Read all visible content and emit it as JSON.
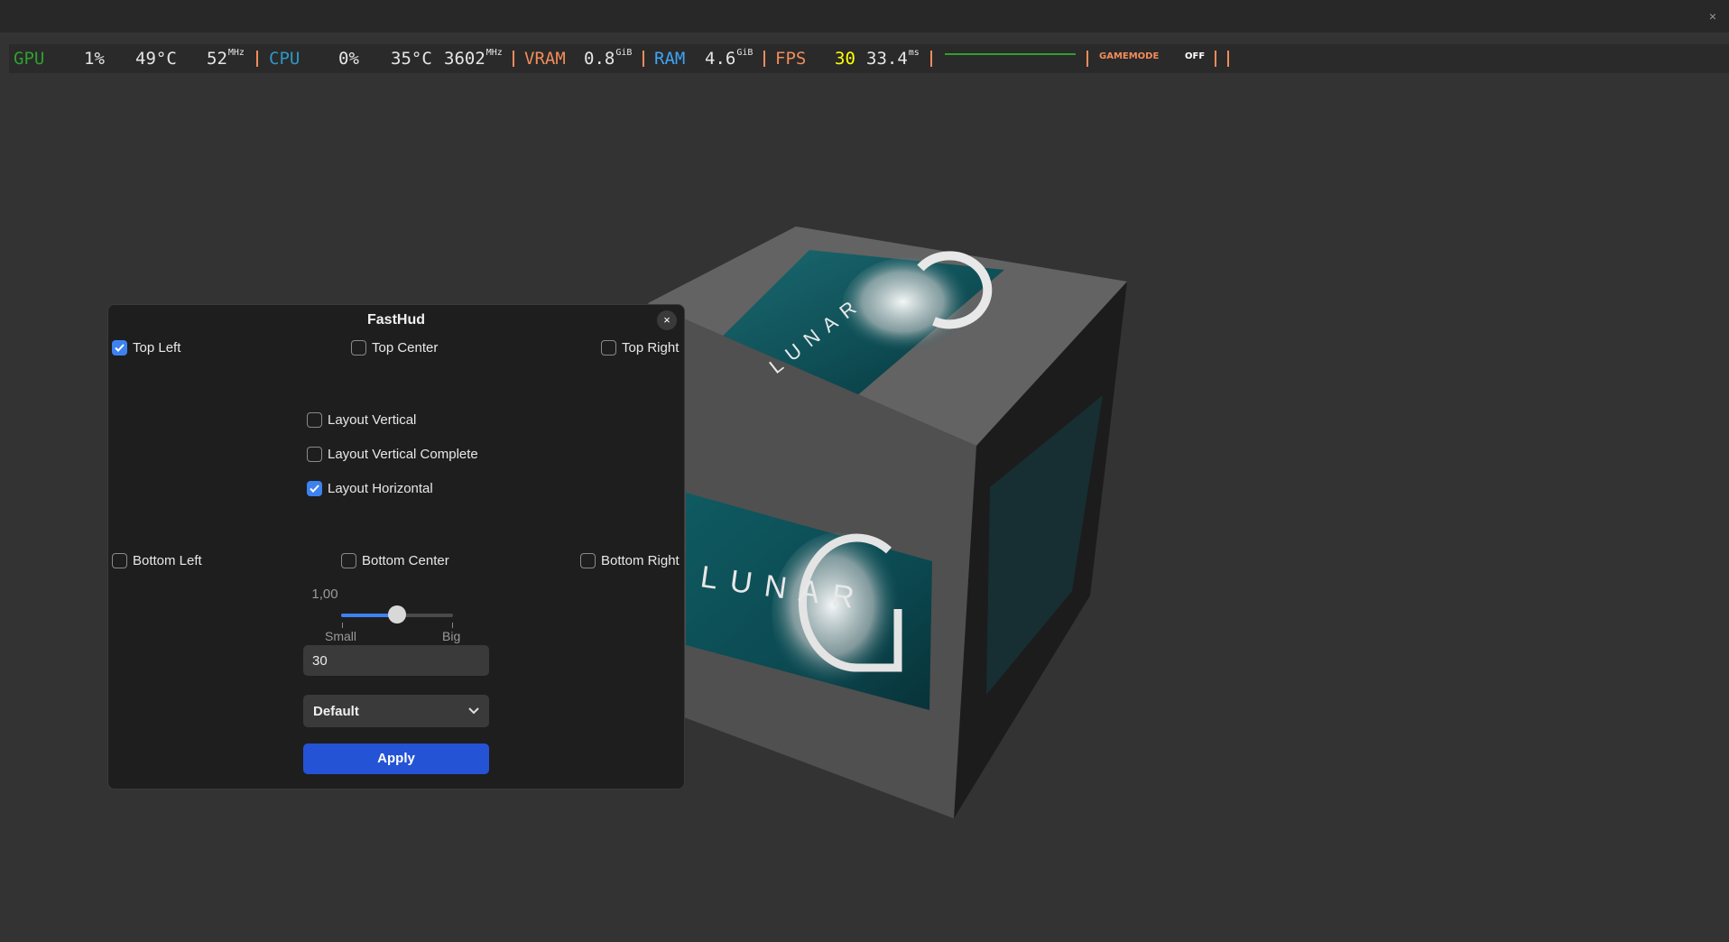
{
  "window": {
    "close_label": "×"
  },
  "hud": {
    "gpu_label": "GPU",
    "gpu_load": "1%",
    "gpu_temp": "49°C",
    "gpu_clock": "52",
    "gpu_clock_unit": "MHz",
    "cpu_label": "CPU",
    "cpu_load": "0%",
    "cpu_temp": "35°C",
    "cpu_clock": "3602",
    "cpu_clock_unit": "MHz",
    "vram_label": "VRAM",
    "vram_value": "0.8",
    "vram_unit": "GiB",
    "ram_label": "RAM",
    "ram_value": "4.6",
    "ram_unit": "GiB",
    "fps_label": "FPS",
    "fps_value": "30",
    "frametime": "33.4",
    "frametime_unit": "ms",
    "gamemode_label": "GAMEMODE",
    "gamemode_value": "OFF",
    "colors": {
      "gpu": "#2ea02e",
      "cpu": "#2e97c8",
      "vram": "#f28c5a",
      "ram": "#3da5f5",
      "fps": "#f28c5a",
      "fps_value": "#ffff00",
      "separator": "#f28c5a"
    }
  },
  "scene": {
    "cube_logo_text": "LUNAR",
    "cube_logo_letter": "G"
  },
  "dialog": {
    "title": "FastHud",
    "close_label": "×",
    "positions": {
      "top_left": {
        "label": "Top Left",
        "checked": true
      },
      "top_center": {
        "label": "Top Center",
        "checked": false
      },
      "top_right": {
        "label": "Top Right",
        "checked": false
      },
      "bottom_left": {
        "label": "Bottom Left",
        "checked": false
      },
      "bottom_center": {
        "label": "Bottom Center",
        "checked": false
      },
      "bottom_right": {
        "label": "Bottom Right",
        "checked": false
      }
    },
    "layouts": {
      "vertical": {
        "label": "Layout Vertical",
        "checked": false
      },
      "vertical_complete": {
        "label": "Layout Vertical Complete",
        "checked": false
      },
      "horizontal": {
        "label": "Layout Horizontal",
        "checked": true
      }
    },
    "scale": {
      "value_text": "1,00",
      "level": 0.5,
      "min_label": "Small",
      "max_label": "Big"
    },
    "fps_limit": {
      "value": "30"
    },
    "preset": {
      "selected": "Default"
    },
    "apply_label": "Apply",
    "accent_color": "#3d82f0",
    "apply_color": "#2453d6"
  }
}
